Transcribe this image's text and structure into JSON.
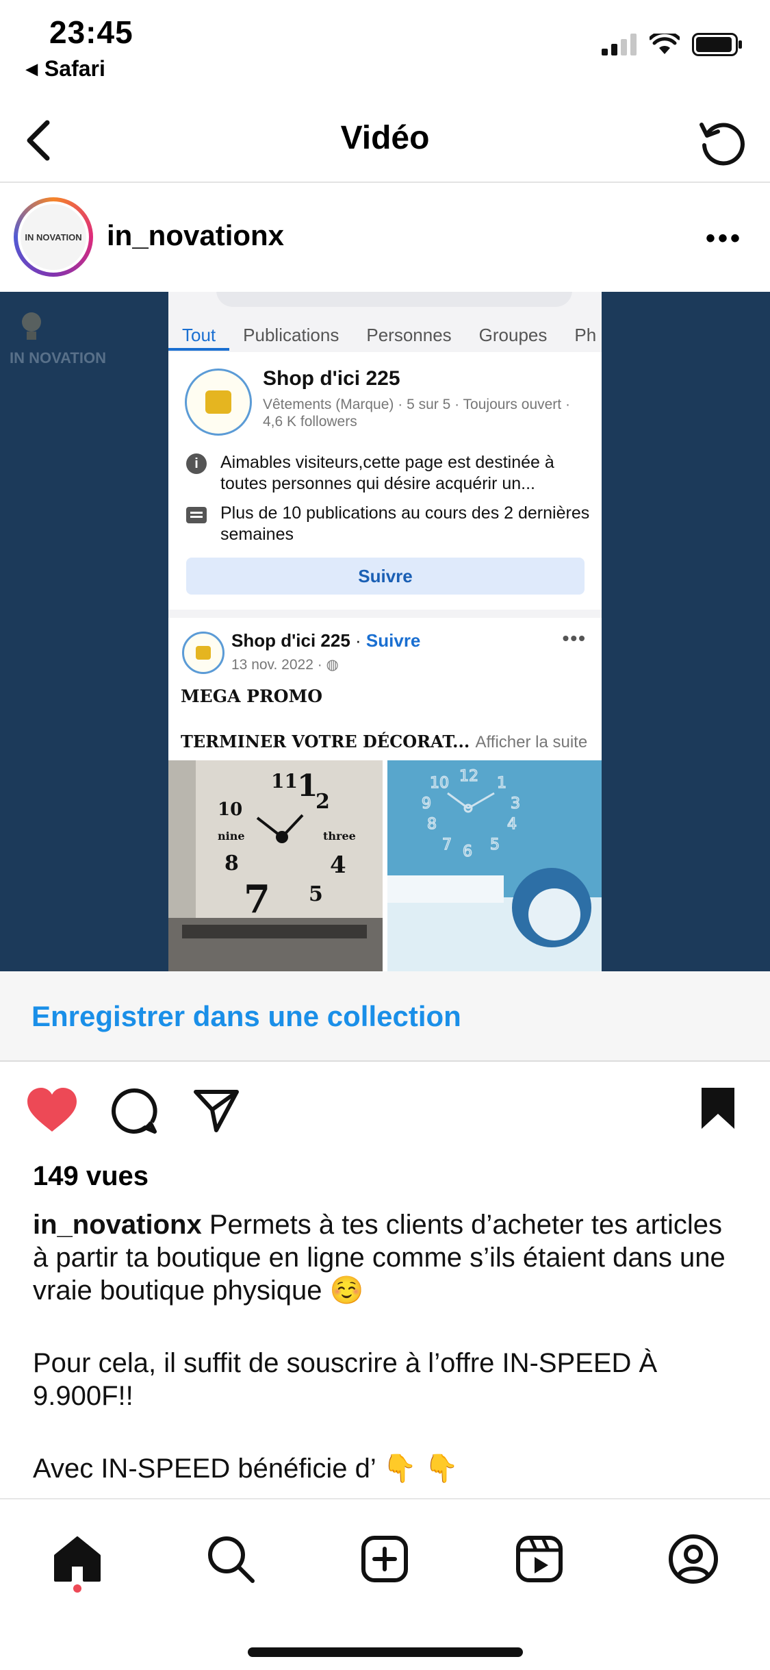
{
  "status_bar": {
    "time": "23:45",
    "back_app": "Safari",
    "back_arrow": "◀"
  },
  "nav": {
    "title": "Vidéo"
  },
  "post": {
    "username": "in_novationx",
    "more": "•••",
    "avatar_text": "IN NOVATION",
    "media_logo_text": "IN NOVATION"
  },
  "facebook_screen": {
    "tabs": [
      "Tout",
      "Publications",
      "Personnes",
      "Groupes",
      "Ph"
    ],
    "page_name": "Shop d'ici 225",
    "page_meta": "Vêtements (Marque) · 5 sur 5 · Toujours ouvert · 4,6 K followers",
    "info_rows": [
      "Aimables visiteurs,cette page est destinée à toutes personnes qui désire acquérir un...",
      "Plus de 10 publications au cours des 2 dernières semaines"
    ],
    "follow_button": "Suivre",
    "post_author": "Shop d'ici 225",
    "post_follow": "Suivre",
    "post_date": "13 nov. 2022 · ",
    "post_dots": "•••",
    "post_title": "MEGA PROMO",
    "post_line": "TERMINER VOTRE DÉCORAT...",
    "post_more": "Afficher la suite"
  },
  "save_collection": "Enregistrer dans une collection",
  "views": "149 vues",
  "caption": {
    "author": "in_novationx",
    "paragraph1": " Permets à tes clients d’acheter tes articles à partir ta boutique en ligne comme s’ils étaient dans une vraie boutique physique ☺️",
    "paragraph2": "Pour cela, il suffit de souscrire à l’offre IN-SPEED À 9.900F!!",
    "paragraph3": "Avec IN-SPEED bénéficie d’ 👇 👇"
  },
  "colors": {
    "link_blue": "#1a8fe8",
    "like_red": "#ed4956",
    "media_bg": "#1c3a5a",
    "fb_blue": "#1a6fd1"
  },
  "icons": {
    "nav_back": "chevron-left-icon",
    "nav_refresh": "refresh-icon",
    "like": "heart-icon",
    "comment": "comment-icon",
    "share": "paper-plane-icon",
    "save": "bookmark-icon",
    "tabs": [
      "home-icon",
      "search-icon",
      "add-post-icon",
      "reels-icon",
      "profile-icon"
    ]
  }
}
